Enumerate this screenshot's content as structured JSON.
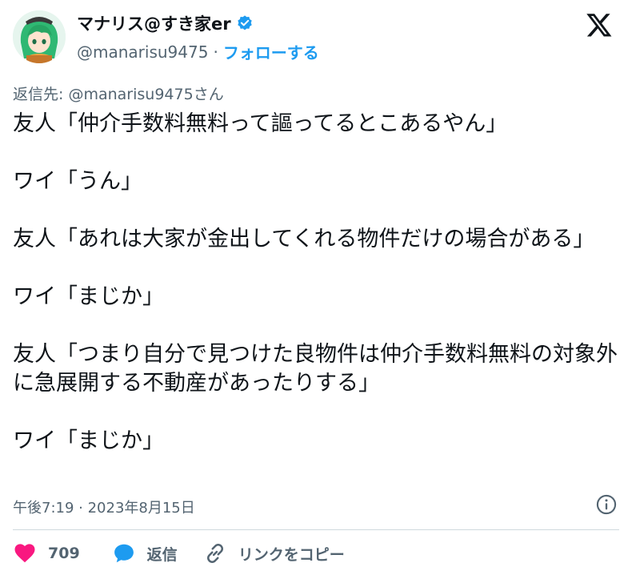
{
  "author": {
    "display_name": "マナリス@すき家er",
    "handle": "@manarisu9475",
    "separator": "·",
    "follow_label": "フォローする"
  },
  "reply_to": {
    "prefix": "返信先: ",
    "mention": "@manarisu9475",
    "suffix": "さん"
  },
  "tweet": {
    "paragraphs": [
      "友人「仲介手数料無料って謳ってるとこあるやん」",
      "ワイ「うん」",
      "友人「あれは大家が金出してくれる物件だけの場合がある」",
      "ワイ「まじか」",
      "友人「つまり自分で見つけた良物件は仲介手数料無料の対象外に急展開する不動産があったりする」",
      "ワイ「まじか」"
    ]
  },
  "timestamp": "午後7:19 · 2023年8月15日",
  "actions": {
    "like_count": "709",
    "reply_label": "返信",
    "copy_link_label": "リンクをコピー"
  },
  "colors": {
    "accent": "#1d9bf0",
    "like": "#f91880",
    "muted": "#536471",
    "text": "#0f1419"
  }
}
